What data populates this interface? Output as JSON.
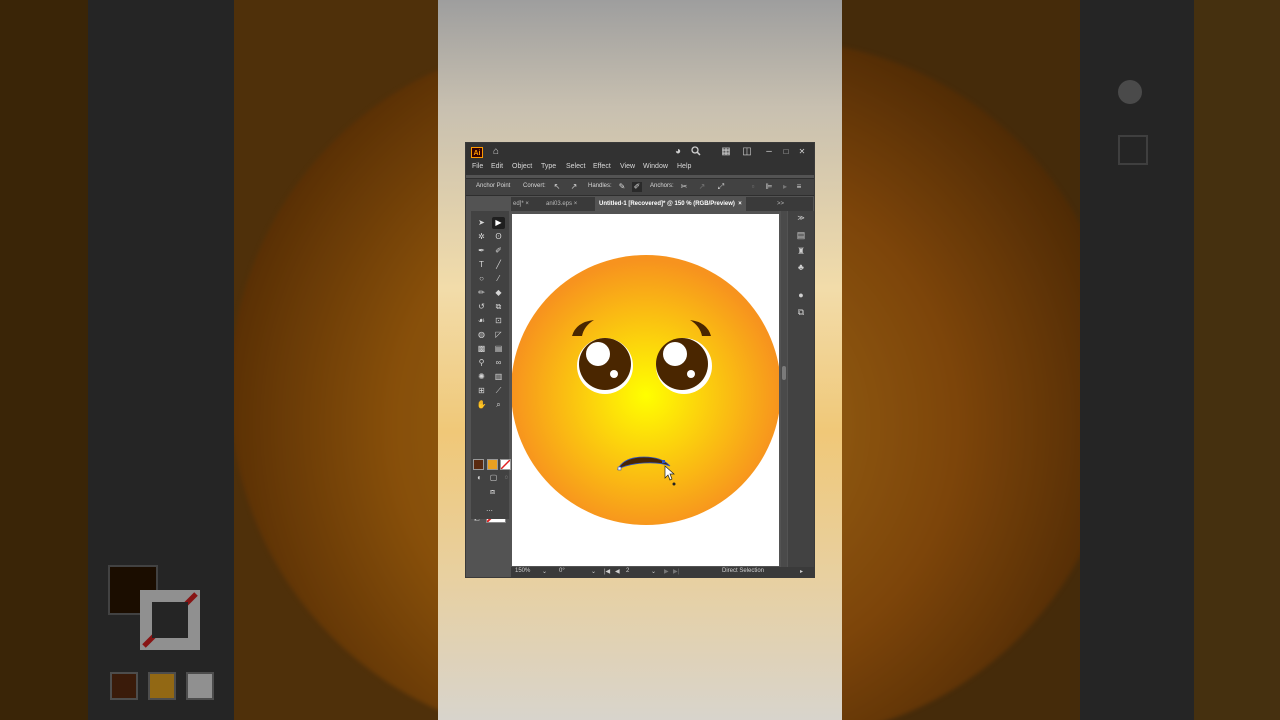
{
  "window": {
    "app_logo": "Ai",
    "icons": [
      "home-icon",
      "cloud-user-icon",
      "search-icon",
      "arrange-documents-icon",
      "workspace-icon",
      "minimize-icon",
      "maximize-icon",
      "close-icon"
    ],
    "window_controls": {
      "minimize": "–",
      "maximize": "□",
      "close": "✕"
    }
  },
  "menu": [
    "File",
    "Edit",
    "Object",
    "Type",
    "Select",
    "Effect",
    "View",
    "Window",
    "Help"
  ],
  "control_bar": {
    "mode_label": "Anchor Point",
    "convert_label": "Convert:",
    "handles_label": "Handles:",
    "anchors_label": "Anchors:"
  },
  "tabs": [
    {
      "label": "ed]*",
      "close": "×"
    },
    {
      "label": "ani03.eps",
      "close": "×"
    },
    {
      "label": "Untitled-1 [Recovered]* @ 150 % (RGB/Preview)",
      "close": "×",
      "active": true
    }
  ],
  "tabs_overflow": ">>",
  "toolbar": {
    "more_tools": "..."
  },
  "colors": {
    "fill": "#4a2600",
    "stroke": "none",
    "face_light": "#ffff00",
    "face_dark": "#f7931e",
    "feature": "#4a2600",
    "ui_dark": "#323232",
    "ui_mid": "#535353"
  },
  "status_bar": {
    "zoom": "150%",
    "rotation": "0°",
    "artboard_nav_first": "|◀",
    "artboard_nav_prev": "◀",
    "artboard_number": "2",
    "artboard_nav_next": "▶",
    "artboard_nav_last": "▶|",
    "tool_name": "Direct Selection"
  }
}
